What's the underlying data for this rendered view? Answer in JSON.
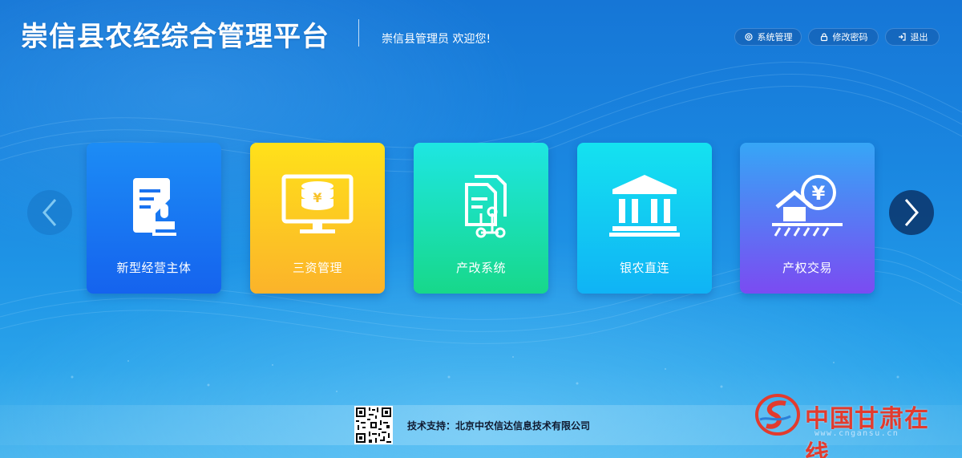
{
  "header": {
    "title": "崇信县农经综合管理平台",
    "welcome": "崇信县管理员 欢迎您!",
    "buttons": [
      {
        "label": "系统管理",
        "icon": "gear-icon"
      },
      {
        "label": "修改密码",
        "icon": "lock-icon"
      },
      {
        "label": "退出",
        "icon": "logout-icon"
      }
    ]
  },
  "nav": {
    "prev_icon": "chevron-left-icon",
    "next_icon": "chevron-right-icon"
  },
  "cards": [
    {
      "label": "新型经营主体",
      "icon": "document-stamp-icon",
      "color": "#1563ee"
    },
    {
      "label": "三资管理",
      "icon": "monitor-yuan-icon",
      "color": "#fbb32a"
    },
    {
      "label": "产改系统",
      "icon": "document-flow-icon",
      "color": "#17d88a"
    },
    {
      "label": "银农直连",
      "icon": "bank-icon",
      "color": "#10b3f5"
    },
    {
      "label": "产权交易",
      "icon": "house-yuan-icon",
      "color": "#7b4bf2"
    }
  ],
  "footer": {
    "support": "技术支持：北京中农信达信息技术有限公司",
    "qr_icon": "qr-code-icon"
  },
  "watermark": {
    "text": "中国甘肃在线",
    "url": "www.cngansu.cn",
    "color": "#e23b2e"
  }
}
